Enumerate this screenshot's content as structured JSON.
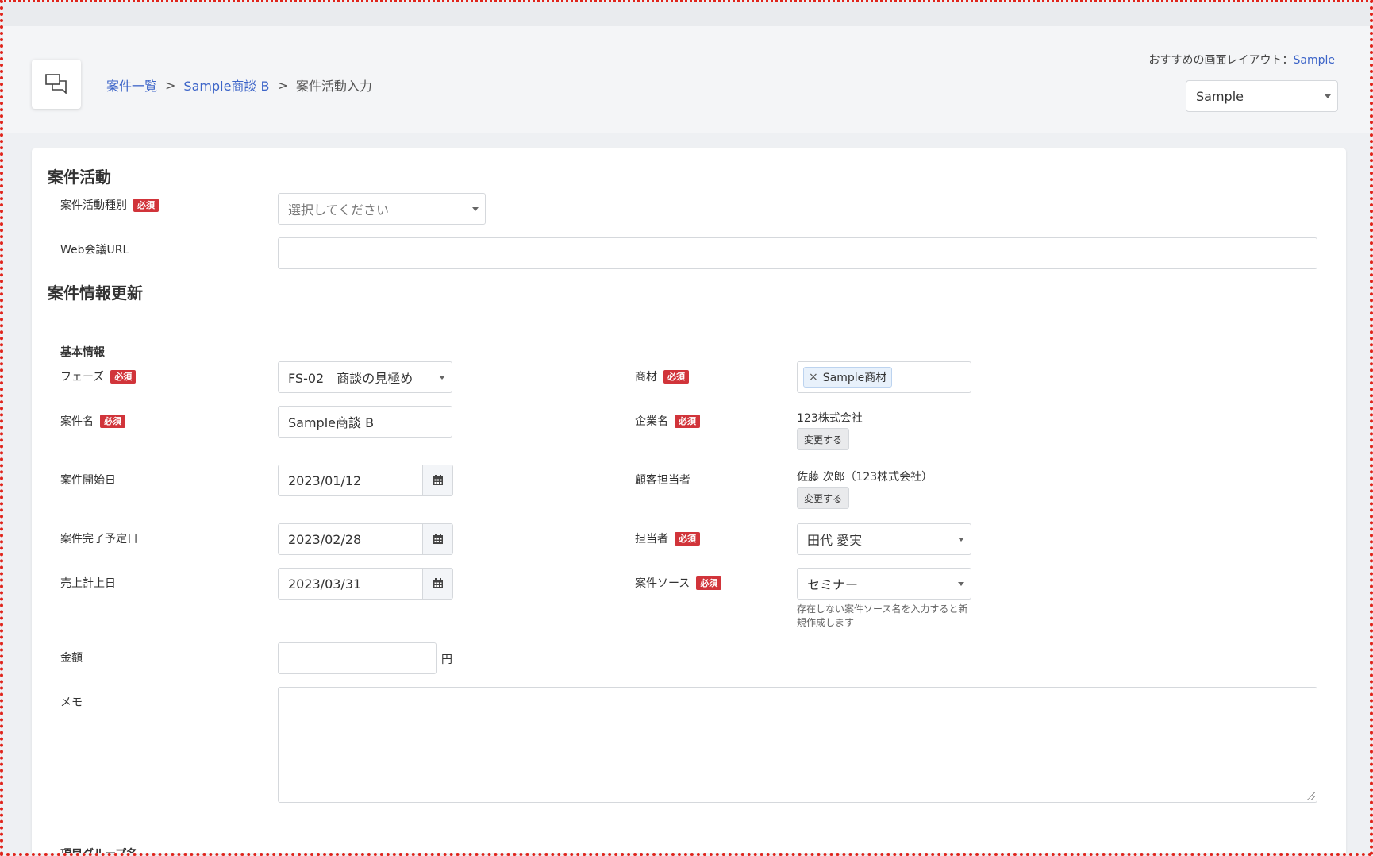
{
  "header": {
    "breadcrumb": [
      "案件一覧",
      "Sample商談 B",
      "案件活動入力"
    ],
    "separator": ">",
    "layout_label": "おすすめの画面レイアウト：",
    "layout_link": "Sample",
    "layout_select": "Sample"
  },
  "activity": {
    "title": "案件活動",
    "type_label": "案件活動種別",
    "type_placeholder": "選択してください",
    "web_url_label": "Web会議URL",
    "web_url_value": ""
  },
  "update": {
    "title": "案件情報更新",
    "basic_info": "基本情報",
    "required_badge": "必須",
    "phase_label": "フェーズ",
    "phase_value": "FS-02　商談の見極め",
    "deal_name_label": "案件名",
    "deal_name_value": "Sample商談 B",
    "start_date_label": "案件開始日",
    "start_date_value": "2023/01/12",
    "end_date_label": "案件完了予定日",
    "end_date_value": "2023/02/28",
    "sales_date_label": "売上計上日",
    "sales_date_value": "2023/03/31",
    "amount_label": "金額",
    "amount_value": "",
    "amount_unit": "円",
    "memo_label": "メモ",
    "product_label": "商材",
    "product_chip": "Sample商材",
    "product_chip_remove": "×",
    "company_label": "企業名",
    "company_value": "123株式会社",
    "change_button": "変更する",
    "contact_label": "顧客担当者",
    "contact_value": "佐藤 次郎（123株式会社）",
    "owner_label": "担当者",
    "owner_value": "田代 愛実",
    "source_label": "案件ソース",
    "source_value": "セミナー",
    "source_hint_1": "存在しない案件ソース名を入力すると新",
    "source_hint_2": "規作成します",
    "group_name": "項目グループ名"
  }
}
